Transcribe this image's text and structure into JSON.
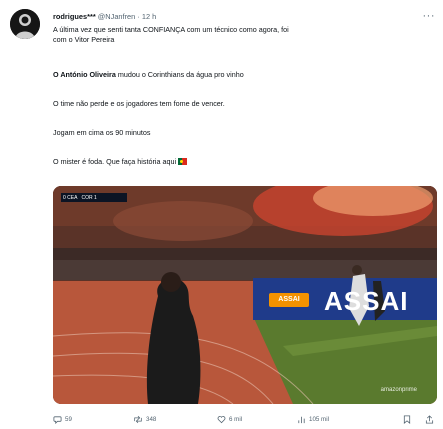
{
  "tweet": {
    "author_name": "rodrigues***",
    "handle": "@NJanfren",
    "time": "12 h",
    "more_glyph": "···",
    "text_line1": "A última vez que senti tanta CONFIANÇA com um técnico como agora, foi",
    "text_line2": "com o Vitor Pereira",
    "para1_bold": "O António Oliveira",
    "para1_rest": " mudou o Corinthians da água pro vinho",
    "para2": "O time não perde e os jogadores tem fome de vencer.",
    "para3": "Jogam em cima os 90 minutos",
    "para4": "O mister é foda. Que faça história aqui",
    "flag_icon": "portugal-flag-icon"
  },
  "media": {
    "score_home": "0 CEA",
    "score_away": "COR 1",
    "ad_text": "ASSAI",
    "ad_logo": "ASSAI",
    "watermark": "amazonprime"
  },
  "actions": {
    "replies": "59",
    "retweets": "348",
    "likes": "6 mil",
    "views": "105 mil"
  },
  "colors": {
    "text": "#0f1419",
    "secondary": "#536471",
    "pitch": "#5a7a2e",
    "track": "#b8573b"
  }
}
